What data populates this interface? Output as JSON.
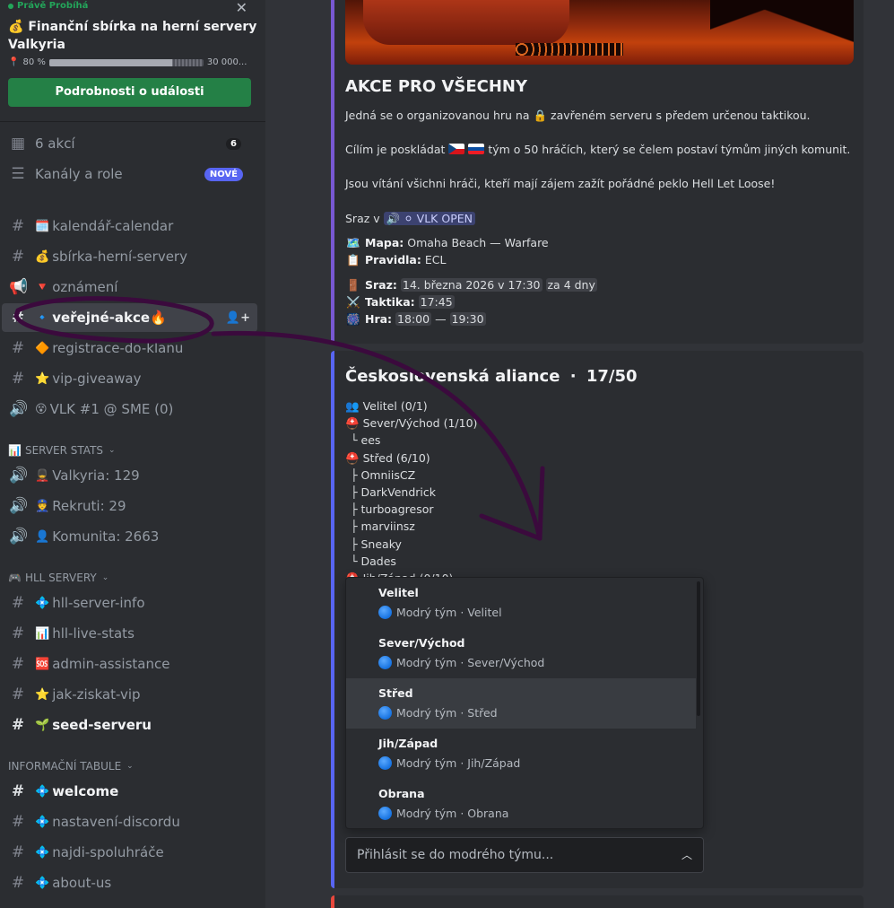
{
  "event": {
    "status": "Právě Probíhá",
    "title_emoji": "💰",
    "title": "Finanční sbírka na herní servery Valkyria",
    "progress_percent_text": "80 %",
    "progress_fraction": 0.8,
    "progress_goal": "30 000...",
    "details_button": "Podrobnosti o události"
  },
  "sidebar_top": [
    {
      "icon": "calendar-icon",
      "label": "6 akcí",
      "count": "6"
    },
    {
      "icon": "channels-roles-icon",
      "label": "Kanály a role",
      "badge": "NOVÉ"
    }
  ],
  "channels_main": [
    {
      "icon": "#",
      "emoji": "🗓️",
      "label": "kalendář-calendar"
    },
    {
      "icon": "#",
      "emoji": "💰",
      "label": "sbírka-herní-servery"
    },
    {
      "icon": "📢",
      "emoji": "🔻",
      "label": "oznámení"
    },
    {
      "icon": "#",
      "emoji": "🔹",
      "label": "veřejné-akce🔥"
    },
    {
      "icon": "#",
      "emoji": "🔶",
      "label": "registrace-do-klanu"
    },
    {
      "icon": "#",
      "emoji": "⭐",
      "label": "vip-giveaway"
    },
    {
      "icon": "🔊",
      "emoji": "😵",
      "label": "VLK #1 @ SME (0)"
    }
  ],
  "categories": {
    "server_stats": "SERVER STATS",
    "hll_servery": "HLL SERVERY",
    "info": "INFORMAČNÍ TABULE"
  },
  "channels_stats": [
    {
      "emoji": "💂",
      "label": "Valkyria: 129"
    },
    {
      "emoji": "👮",
      "label": "Rekruti: 29"
    },
    {
      "emoji": "👤",
      "label": "Komunita: 2663"
    }
  ],
  "channels_hll": [
    {
      "emoji": "💠",
      "label": "hll-server-info"
    },
    {
      "emoji": "📊",
      "label": "hll-live-stats"
    },
    {
      "emoji": "🆘",
      "label": "admin-assistance"
    },
    {
      "emoji": "⭐",
      "label": "jak-ziskat-vip"
    },
    {
      "emoji": "🌱",
      "label": "seed-serveru"
    }
  ],
  "channels_info": [
    {
      "emoji": "💠",
      "label": "welcome"
    },
    {
      "emoji": "💠",
      "label": "nastavení-discordu"
    },
    {
      "emoji": "💠",
      "label": "najdi-spoluhráče"
    },
    {
      "emoji": "💠",
      "label": "about-us"
    }
  ],
  "embed1": {
    "title": "AKCE PRO VŠECHNY",
    "line1_a": "Jedná se o organizovanou hru na",
    "line1_b": "zavřeném serveru s předem určenou taktikou.",
    "line2_a": "Cílím je poskládat",
    "line2_b": "tým o 50 hráčích, který se čelem postaví týmům jiných komunit.",
    "line3": "Jsou vítání všichni hráči, kteří mají zájem zažít pořádné peklo Hell Let Loose!",
    "sraz_prefix": "Sraz v",
    "sraz_channel": "⚪ VLK OPEN",
    "map_label": "Mapa:",
    "map_value": "Omaha Beach — Warfare",
    "rules_label": "Pravidla:",
    "rules_value": "ECL",
    "meet_label": "Sraz:",
    "meet_date": "14. března 2026 v 17:30",
    "meet_rel": "za 4 dny",
    "tactic_label": "Taktika:",
    "tactic_time": "17:45",
    "game_label": "Hra:",
    "game_start": "18:00",
    "game_dash": "—",
    "game_end": "19:30"
  },
  "embed2": {
    "title": "Československá aliance",
    "count": "17/50",
    "tree": [
      "Velitel (0/1)",
      "Sever/Východ (1/10)",
      "└ ees",
      "Střed (6/10)",
      "├ OmniisCZ",
      "├ DarkVendrick",
      "├ turboagresor",
      "├ marviinsz",
      "├ Sneaky",
      "└ Dades",
      "Jih/Západ (0/10)"
    ],
    "options": [
      {
        "title": "Velitel",
        "desc": "Modrý tým · Velitel"
      },
      {
        "title": "Sever/Východ",
        "desc": "Modrý tým · Sever/Východ"
      },
      {
        "title": "Střed",
        "desc": "Modrý tým · Střed"
      },
      {
        "title": "Jih/Západ",
        "desc": "Modrý tým · Jih/Západ"
      },
      {
        "title": "Obrana",
        "desc": "Modrý tým · Obrana"
      }
    ],
    "select_placeholder": "Přihlásit se do modrého týmu..."
  },
  "colors": {
    "accent_blurple": "#5865f2",
    "green": "#248046",
    "annotation_purple": "#3b0a3d"
  }
}
